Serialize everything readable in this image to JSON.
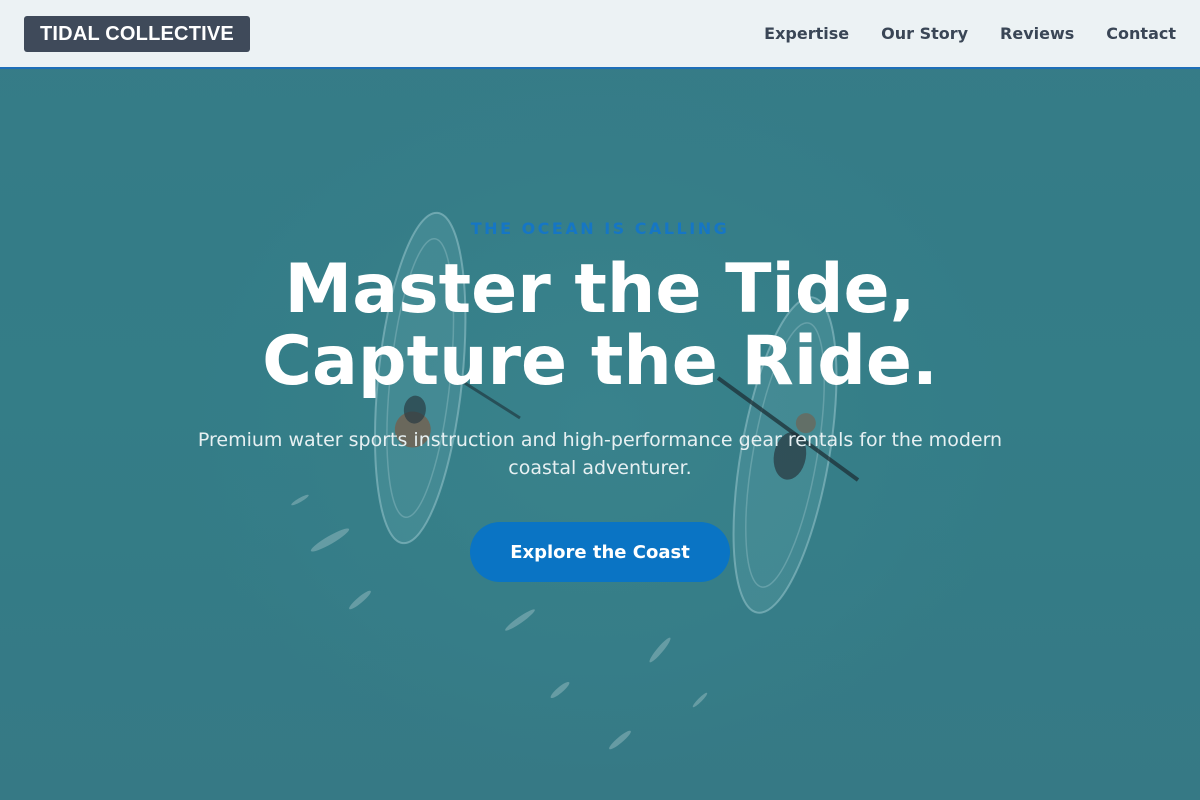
{
  "header": {
    "logo": "TIDAL COLLECTIVE",
    "nav": [
      {
        "label": "Expertise"
      },
      {
        "label": "Our Story"
      },
      {
        "label": "Reviews"
      },
      {
        "label": "Contact"
      }
    ]
  },
  "hero": {
    "eyebrow": "THE OCEAN IS CALLING",
    "title_line1": "Master the Tide,",
    "title_line2": "Capture the Ride.",
    "subtitle": "Premium water sports instruction and high-performance gear rentals for the modern coastal adventurer.",
    "cta_label": "Explore the Coast",
    "background_image": "aerial-kayaks-photo"
  },
  "colors": {
    "header_bg": "#f4f7f9",
    "logo_bg": "#3f4a5a",
    "accent": "#0a74c4",
    "ocean": "#3a7f88",
    "nav_text": "#3a4656"
  }
}
